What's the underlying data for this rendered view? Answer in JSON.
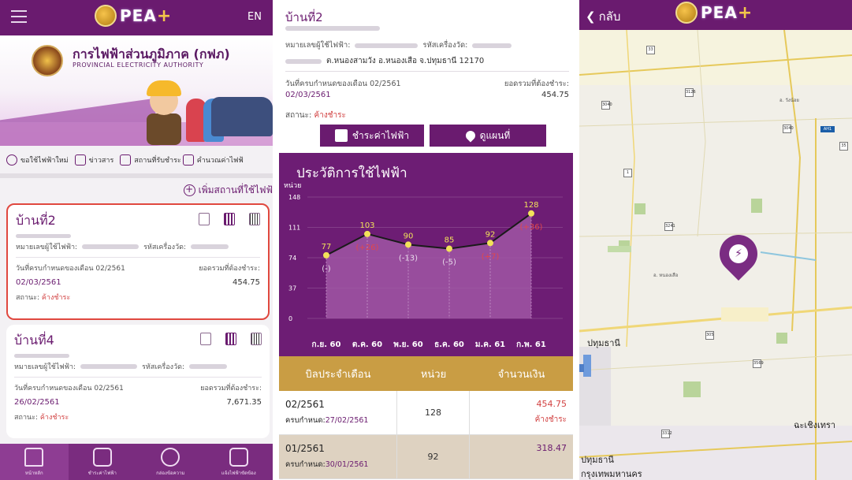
{
  "panel1": {
    "header": {
      "brand": "PEA",
      "lang": "EN"
    },
    "banner": {
      "title_th": "การไฟฟ้าส่วนภูมิภาค (กฟภ)",
      "title_en": "PROVINCIAL ELECTRICITY AUTHORITY"
    },
    "menu": [
      "ขอใช้ไฟฟ้าใหม่",
      "ข่าวสาร",
      "สถานที่รับชำระ",
      "คำนวณค่าไฟฟ้"
    ],
    "add_place": "เพิ่มสถานที่ใช้ไฟฟ้",
    "cards": [
      {
        "title": "บ้านที่2",
        "meter_label": "หมายเลขผู้ใช้ไฟฟ้า:",
        "meter_no_label": "รหัสเครื่องวัด:",
        "due_label": "วันที่ครบกำหนดของเดือน 02/2561",
        "total_label": "ยอดรวมที่ต้องชำระ:",
        "date": "02/03/2561",
        "amount": "454.75",
        "status_label": "สถานะ:",
        "status_value": "ค้างชำระ"
      },
      {
        "title": "บ้านที่4",
        "meter_label": "หมายเลขผู้ใช้ไฟฟ้า:",
        "meter_no_label": "รหัสเครื่องวัด:",
        "due_label": "วันที่ครบกำหนดของเดือน 02/2561",
        "total_label": "ยอดรวมที่ต้องชำระ:",
        "date": "26/02/2561",
        "amount": "7,671.35",
        "status_label": "สถานะ:",
        "status_value": "ค้างชำระ"
      }
    ],
    "nav": [
      "หน้าหลัก",
      "ชำระค่าไฟฟ้า",
      "กล่องข้อความ",
      "แจ้งไฟฟ้าขัดข้อง"
    ]
  },
  "panel2": {
    "title": "บ้านที่2",
    "meter_label": "หมายเลขผู้ใช้ไฟฟ้า:",
    "meter_no_label": "รหัสเครื่องวัด:",
    "address": "ต.หนองสามวัง อ.หนองเสือ จ.ปทุมธานี 12170",
    "due_label": "วันที่ครบกำหนดของเดือน 02/2561",
    "total_label": "ยอดรวมที่ต้องชำระ:",
    "date": "02/03/2561",
    "amount": "454.75",
    "status_label": "สถานะ:",
    "status_value": "ค้างชำระ",
    "btn_pay": "ชำระค่าไฟฟ้า",
    "btn_map": "ดูแผนที่",
    "table": {
      "headers": [
        "บิลประจำเดือน",
        "หน่วย",
        "จำนวนเงิน"
      ],
      "rows": [
        {
          "bill": "02/2561",
          "due_label": "ครบกำหนด:",
          "due": "27/02/2561",
          "units": "128",
          "amount": "454.75",
          "status": "ค้างชำระ"
        },
        {
          "bill": "01/2561",
          "due_label": "ครบกำหนด:",
          "due": "30/01/2561",
          "units": "92",
          "amount": "318.47",
          "status": ""
        }
      ]
    }
  },
  "chart_data": {
    "type": "line",
    "title": "ประวัติการใช้ไฟฟ้า",
    "ylabel": "หน่วย",
    "categories": [
      "ก.ย. 60",
      "ต.ค. 60",
      "พ.ย. 60",
      "ธ.ค. 60",
      "ม.ค. 61",
      "ก.พ. 61"
    ],
    "values": [
      77,
      103,
      90,
      85,
      92,
      128
    ],
    "diffs": [
      "(-)",
      "(+26)",
      "(-13)",
      "(-5)",
      "(+7)",
      "(+36)"
    ],
    "yticks": [
      0,
      37,
      74,
      111,
      148
    ],
    "ylim": [
      0,
      148
    ],
    "colors": {
      "bg": "#6d1d74",
      "fill": "#a35aa8",
      "line": "#1a1a1a",
      "point": "#f2e25a",
      "up": "#e0474c",
      "down": "#e7d9ea"
    }
  },
  "panel3": {
    "back": "กลับ",
    "labels": {
      "pathumthani": "ปทุมธานี",
      "pathumthani2": "ปทุมธานี",
      "bangkok": "กรุงเทพมหานคร",
      "chachoengsao": "ฉะเชิงเทรา",
      "nong_suea": "อ. หนองเสือ",
      "wang_noi": "อ. วังน้อย"
    },
    "roads": [
      "33",
      "3126",
      "3040",
      "3040",
      "1",
      "3241",
      "305",
      "3569",
      "3312",
      "AH1",
      "35"
    ]
  }
}
